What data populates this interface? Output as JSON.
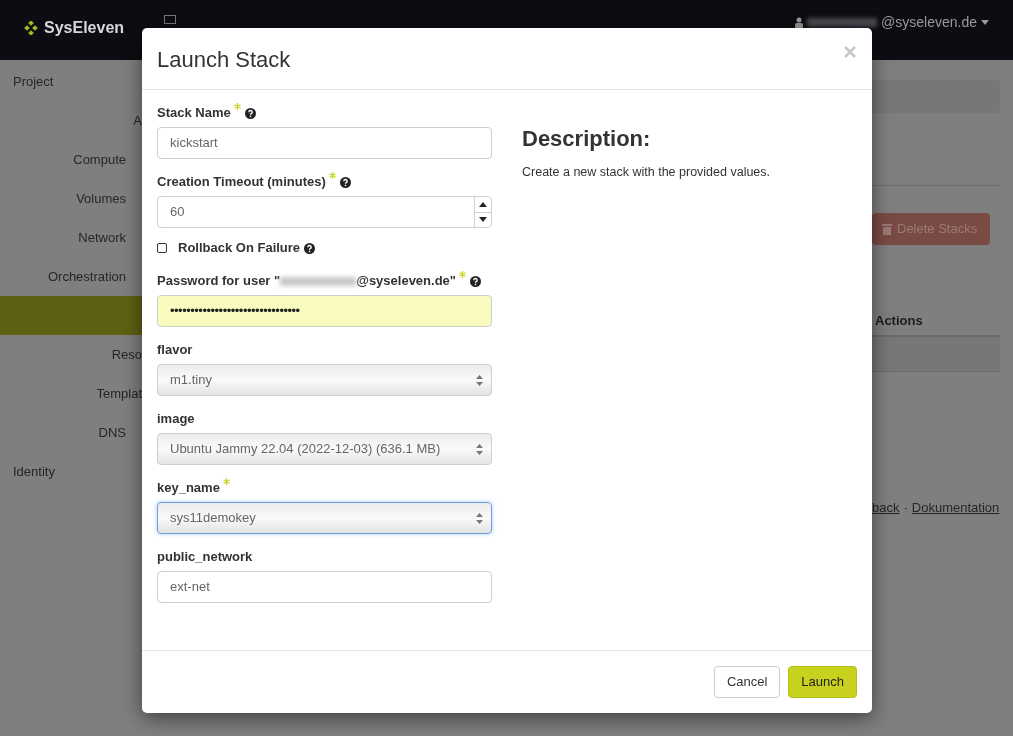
{
  "navbar": {
    "brand": "SysEleven",
    "user_redacted": true,
    "user_after": "@syseleven.de"
  },
  "sidebar": {
    "items": [
      {
        "label": "Project",
        "kind": "top",
        "selected": false
      },
      {
        "label": "A",
        "kind": "sub",
        "selected": false
      },
      {
        "label": "Compute",
        "kind": "group",
        "selected": false
      },
      {
        "label": "Volumes",
        "kind": "group",
        "selected": false
      },
      {
        "label": "Network",
        "kind": "group",
        "selected": false
      },
      {
        "label": "Orchestration",
        "kind": "group",
        "selected": false
      },
      {
        "kind": "sub",
        "selected": true
      },
      {
        "label": "Reso",
        "kind": "sub",
        "selected": false
      },
      {
        "label": "Templat",
        "kind": "sub",
        "selected": false
      },
      {
        "label": "DNS",
        "kind": "group",
        "selected": false
      },
      {
        "label": "Identity",
        "kind": "top",
        "selected": false
      }
    ]
  },
  "content": {
    "delete_button": "Delete Stacks",
    "table_header": "Actions",
    "footer_link_1": "back",
    "footer_separator": "·",
    "footer_link_2": "Dokumentation"
  },
  "modal": {
    "title": "Launch Stack",
    "close": "×",
    "fields": [
      {
        "kind": "text",
        "label": "Stack Name",
        "required": true,
        "help": true,
        "value": "kickstart",
        "focused": false
      },
      {
        "kind": "number",
        "label": "Creation Timeout (minutes)",
        "required": true,
        "help": true,
        "value": "60",
        "focused": false
      },
      {
        "kind": "checkbox",
        "label": "Rollback On Failure",
        "required": false,
        "help": true,
        "checked": false
      },
      {
        "kind": "password",
        "label": "Password for user \"",
        "label_redacted": true,
        "label_after": "@syseleven.de\"",
        "required": true,
        "help": true,
        "value": "••••••••••••••••••••••••••••••••",
        "focused": false
      },
      {
        "kind": "select",
        "label": "flavor",
        "required": false,
        "help": false,
        "value": "m1.tiny",
        "focused": false
      },
      {
        "kind": "select",
        "label": "image",
        "required": false,
        "help": false,
        "value": "Ubuntu Jammy 22.04 (2022-12-03) (636.1 MB)",
        "focused": false
      },
      {
        "kind": "select",
        "label": "key_name",
        "required": true,
        "help": false,
        "value": "sys11demokey",
        "focused": true
      },
      {
        "kind": "text",
        "label": "public_network",
        "required": false,
        "help": false,
        "value": "ext-net",
        "focused": false
      }
    ],
    "description_title": "Description:",
    "description": "Create a new stack with the provided values.",
    "buttons": [
      {
        "label": "Cancel",
        "kind": "default"
      },
      {
        "label": "Launch",
        "kind": "primary"
      }
    ]
  }
}
